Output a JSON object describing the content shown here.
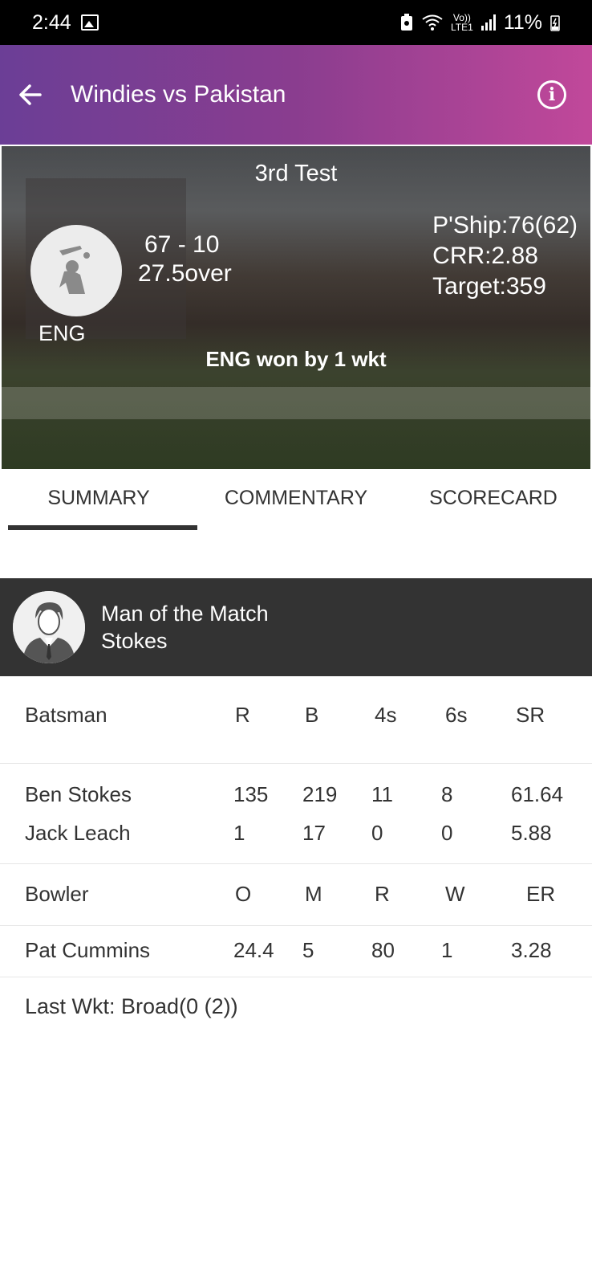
{
  "status": {
    "time": "2:44",
    "network_top": "Vo))",
    "network_bottom": "LTE1",
    "battery": "11%"
  },
  "appbar": {
    "title": "Windies vs Pakistan"
  },
  "hero": {
    "match_name": "3rd Test",
    "team": "ENG",
    "score": "67 - 10",
    "overs": "27.5over",
    "partnership": "P'Ship:76(62)",
    "crr": "CRR:2.88",
    "target": "Target:359",
    "result": "ENG won by 1 wkt"
  },
  "tabs": [
    {
      "label": "SUMMARY",
      "active": true
    },
    {
      "label": "COMMENTARY",
      "active": false
    },
    {
      "label": "SCORECARD",
      "active": false
    }
  ],
  "mom": {
    "title": "Man of the Match",
    "player": "Stokes"
  },
  "batting": {
    "headers": [
      "Batsman",
      "R",
      "B",
      "4s",
      "6s",
      "SR"
    ],
    "rows": [
      [
        "Ben Stokes",
        "135",
        "219",
        "11",
        "8",
        "61.64"
      ],
      [
        "Jack Leach",
        "1",
        "17",
        "0",
        "0",
        "5.88"
      ]
    ]
  },
  "bowling": {
    "headers": [
      "Bowler",
      "O",
      "M",
      "R",
      "W",
      "ER"
    ],
    "rows": [
      [
        "Pat Cummins",
        "24.4",
        "5",
        "80",
        "1",
        "3.28"
      ]
    ]
  },
  "last_wicket": "Last Wkt: Broad(0 (2))",
  "colors": {
    "appbar_start": "#6b3e96",
    "appbar_end": "#c1489a",
    "mom_bg": "#333333"
  }
}
